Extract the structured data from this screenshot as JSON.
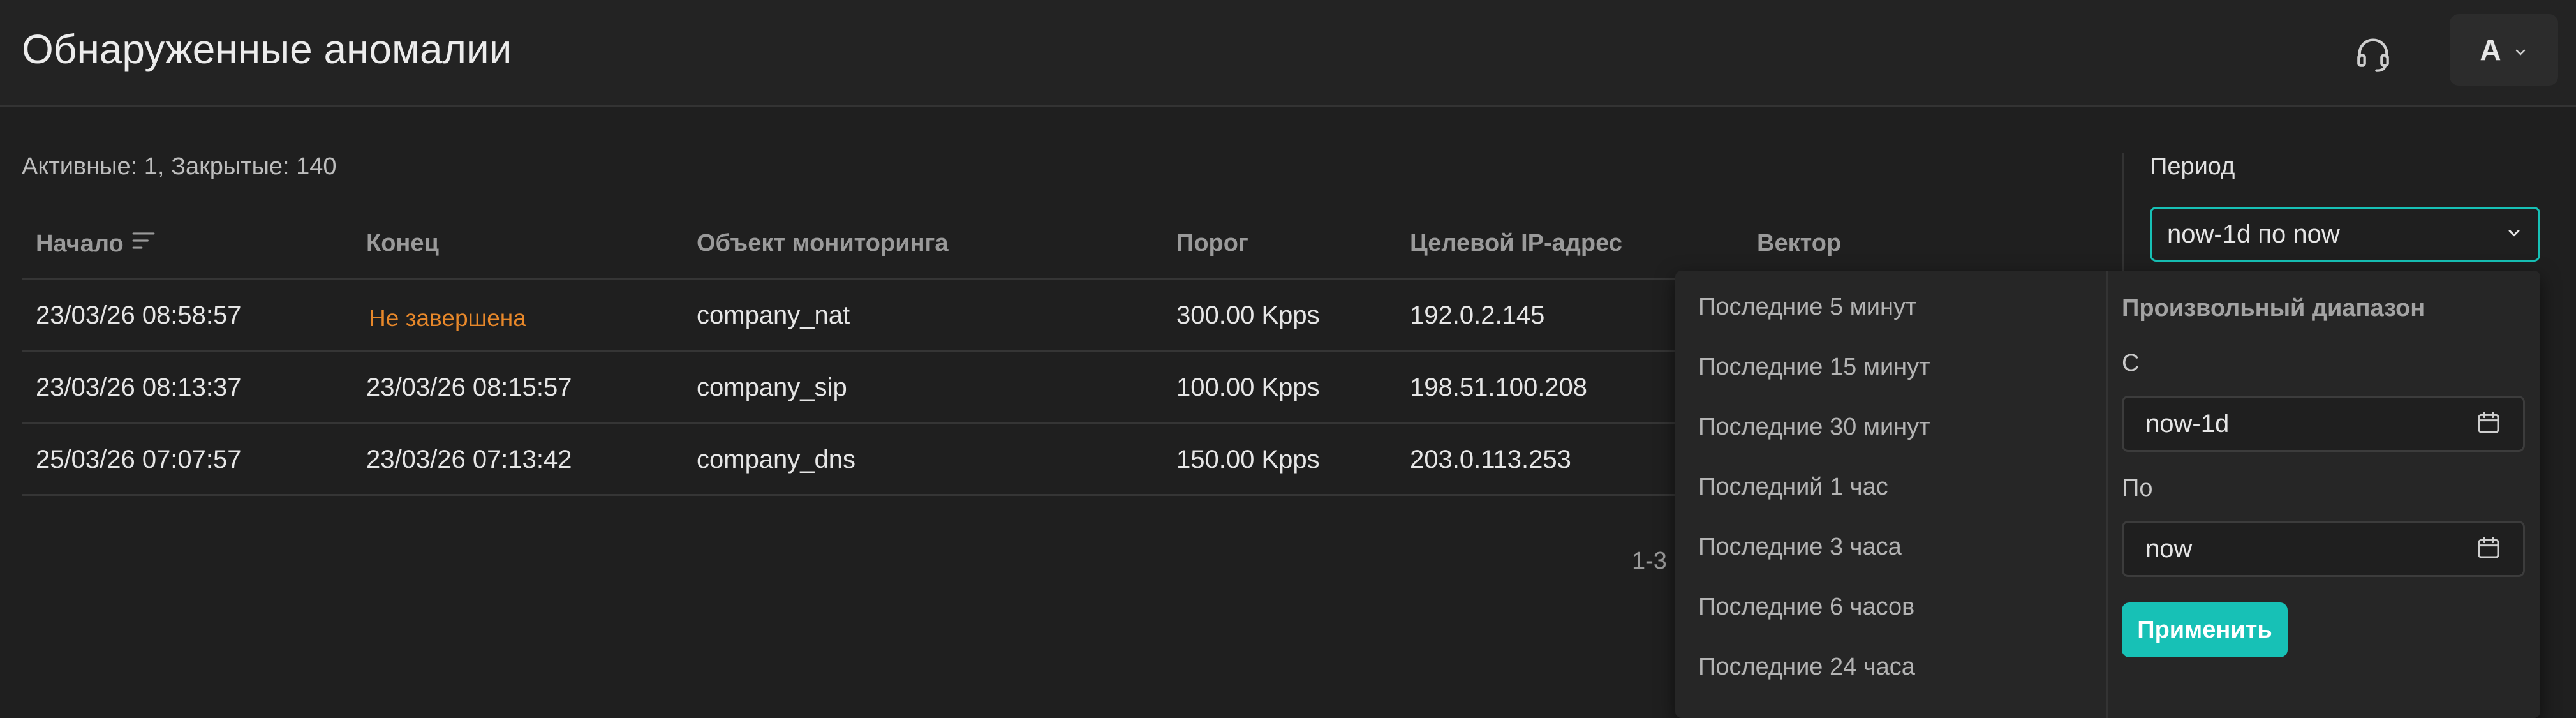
{
  "header": {
    "title": "Обнаруженные аномалии",
    "avatar_label": "A",
    "support_icon": "headset-icon",
    "menu_icon": "chevron-down-icon"
  },
  "summary": "Активные: 1, Закрытые: 140",
  "table": {
    "columns": [
      "Начало",
      "Конец",
      "Объект мониторинга",
      "Порог",
      "Целевой IP-адрес",
      "Вектор"
    ],
    "sort_icon": "sort-lines-icon",
    "rows": [
      {
        "start": "23/03/26 08:58:57",
        "end": "Не завершена",
        "object": "company_nat",
        "threshold": "300.00 Kpps",
        "ip": "192.0.2.145"
      },
      {
        "start": "23/03/26 08:13:37",
        "end": "23/03/26 08:15:57",
        "object": "company_sip",
        "threshold": "100.00 Kpps",
        "ip": "198.51.100.208"
      },
      {
        "start": "25/03/26 07:07:57",
        "end": "23/03/26 07:13:42",
        "object": "company_dns",
        "threshold": "150.00 Kpps",
        "ip": "203.0.113.253"
      }
    ]
  },
  "pagination": "1-3",
  "period": {
    "label": "Период",
    "value": "now-1d по now",
    "quick_ranges": [
      "Последние 5 минут",
      "Последние 15 минут",
      "Последние 30 минут",
      "Последний 1 час",
      "Последние 3 часа",
      "Последние 6 часов",
      "Последние 24 часа"
    ],
    "custom": {
      "title": "Произвольный диапазон",
      "from_label": "С",
      "from_value": "now-1d",
      "to_label": "По",
      "to_value": "now",
      "apply_label": "Применить",
      "calendar_icon": "calendar-icon"
    }
  },
  "colors": {
    "accent": "#17c1b6",
    "warning": "#e8882a",
    "background": "#1f1f1f"
  }
}
